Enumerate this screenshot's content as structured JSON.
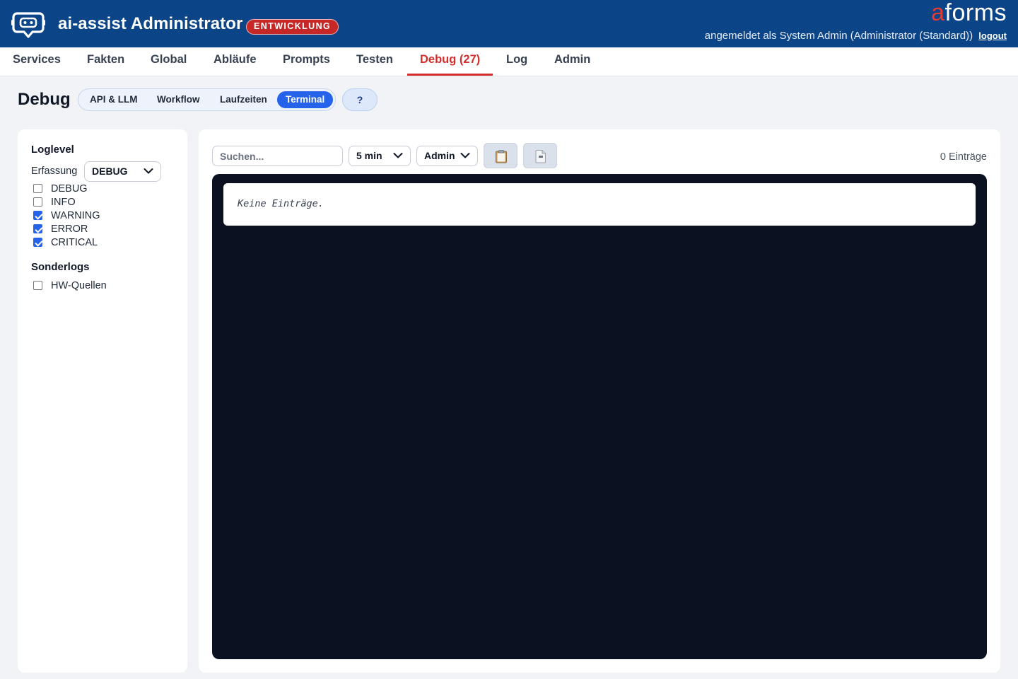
{
  "header": {
    "app_title": "ai-assist Administrator",
    "env_badge": "ENTWICKLUNG",
    "brand_a": "a",
    "brand_rest": "forms",
    "login_text": "angemeldet als System Admin (Administrator (Standard))",
    "logout_label": "logout",
    "logo_icon": "chatbot-icon"
  },
  "nav": {
    "items": [
      {
        "label": "Services"
      },
      {
        "label": "Fakten"
      },
      {
        "label": "Global"
      },
      {
        "label": "Abläufe"
      },
      {
        "label": "Prompts"
      },
      {
        "label": "Testen"
      },
      {
        "label": "Debug (27)"
      },
      {
        "label": "Log"
      },
      {
        "label": "Admin"
      }
    ],
    "active": "Debug (27)"
  },
  "page": {
    "title": "Debug",
    "subtabs": [
      {
        "label": "API & LLM"
      },
      {
        "label": "Workflow"
      },
      {
        "label": "Laufzeiten"
      },
      {
        "label": "Terminal"
      }
    ],
    "active_subtab": "Terminal",
    "help_label": "?"
  },
  "loglevel": {
    "title": "Loglevel",
    "capture_label": "Erfassung",
    "capture_value": "DEBUG",
    "levels": [
      {
        "label": "DEBUG",
        "checked": false
      },
      {
        "label": "INFO",
        "checked": false
      },
      {
        "label": "WARNING",
        "checked": true
      },
      {
        "label": "ERROR",
        "checked": true
      },
      {
        "label": "CRITICAL",
        "checked": true
      }
    ]
  },
  "sonderlogs": {
    "title": "Sonderlogs",
    "items": [
      {
        "label": "HW-Quellen",
        "checked": false
      }
    ]
  },
  "toolbar": {
    "search_placeholder": "Suchen...",
    "time_value": "5 min",
    "user_value": "Admin",
    "copy_icon": "clipboard-icon",
    "download_icon": "file-icon",
    "entry_count": "0 Einträge"
  },
  "terminal": {
    "empty_text": "Keine Einträge."
  },
  "colors": {
    "header_bg": "#0b4487",
    "accent_red": "#d32f2f",
    "accent_blue": "#2563eb",
    "terminal_bg": "#0b1120"
  }
}
